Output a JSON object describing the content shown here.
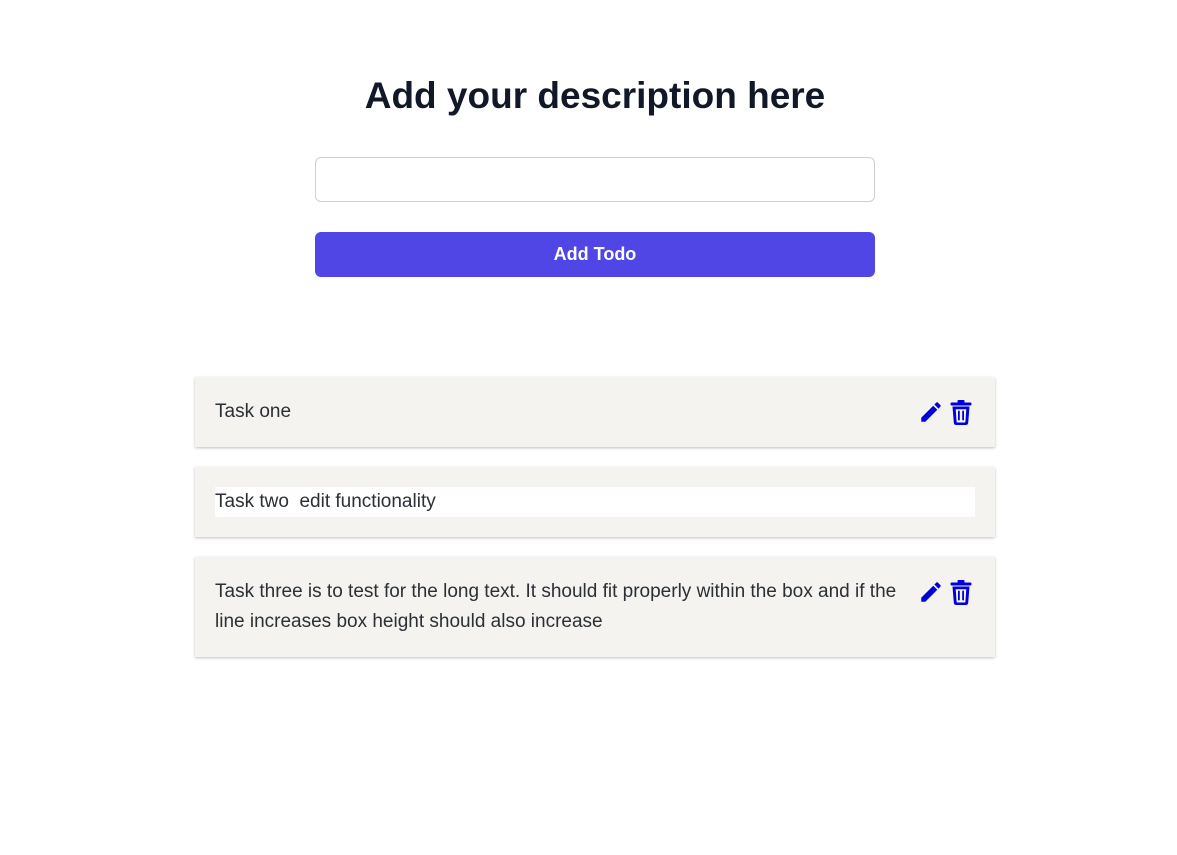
{
  "header": {
    "title": "Add your description here"
  },
  "form": {
    "input_value": "",
    "add_button_label": "Add Todo"
  },
  "colors": {
    "accent": "#4f46e5",
    "icon": "#0000dd",
    "card_background": "#f4f3ef"
  },
  "todos": [
    {
      "text": "Task one",
      "editing": false,
      "icons": [
        "pencil-icon",
        "trash-icon"
      ]
    },
    {
      "text": "Task two  edit functionality",
      "editing": true,
      "icons": []
    },
    {
      "text": "Task three is to test for the long text. It should fit properly within the box and if the line increases box height should also increase",
      "editing": false,
      "icons": [
        "pencil-icon",
        "trash-icon"
      ]
    }
  ]
}
